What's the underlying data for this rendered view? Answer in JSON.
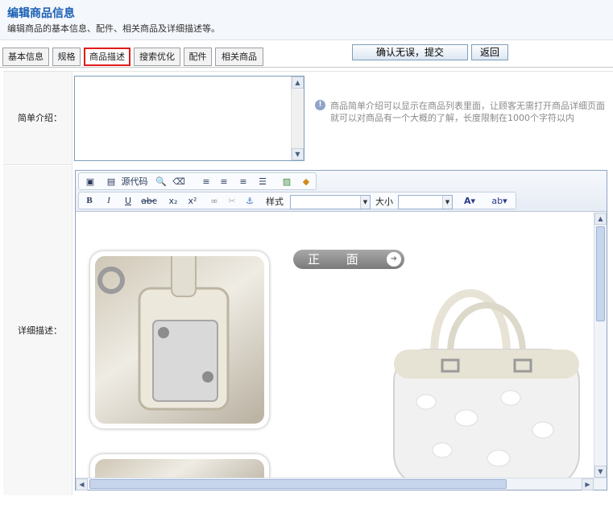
{
  "header": {
    "title": "编辑商品信息",
    "subtitle": "编辑商品的基本信息、配件、相关商品及详细描述等。"
  },
  "tabs": [
    {
      "label": "基本信息",
      "active": false
    },
    {
      "label": "规格",
      "active": false
    },
    {
      "label": "商品描述",
      "active": true
    },
    {
      "label": "搜索优化",
      "active": false
    },
    {
      "label": "配件",
      "active": false
    },
    {
      "label": "相关商品",
      "active": false
    }
  ],
  "actions": {
    "submit_label": "确认无误，提交",
    "back_label": "返回"
  },
  "form": {
    "brief_label": "简单介绍：",
    "brief_value": "",
    "brief_hint": "商品简单介绍可以显示在商品列表里面，让顾客无需打开商品详细页面就可以对商品有一个大概的了解，长度限制在1000个字符以内",
    "detail_label": "详细描述："
  },
  "editor": {
    "source_label": "源代码",
    "style_label": "样式",
    "size_label": "大小",
    "style_value": "",
    "size_value": "",
    "content_badge": "正 面"
  },
  "colors": {
    "accent": "#1a5fb4",
    "active_tab_border": "#e01b1b",
    "hint_text": "#8a8a8a"
  }
}
